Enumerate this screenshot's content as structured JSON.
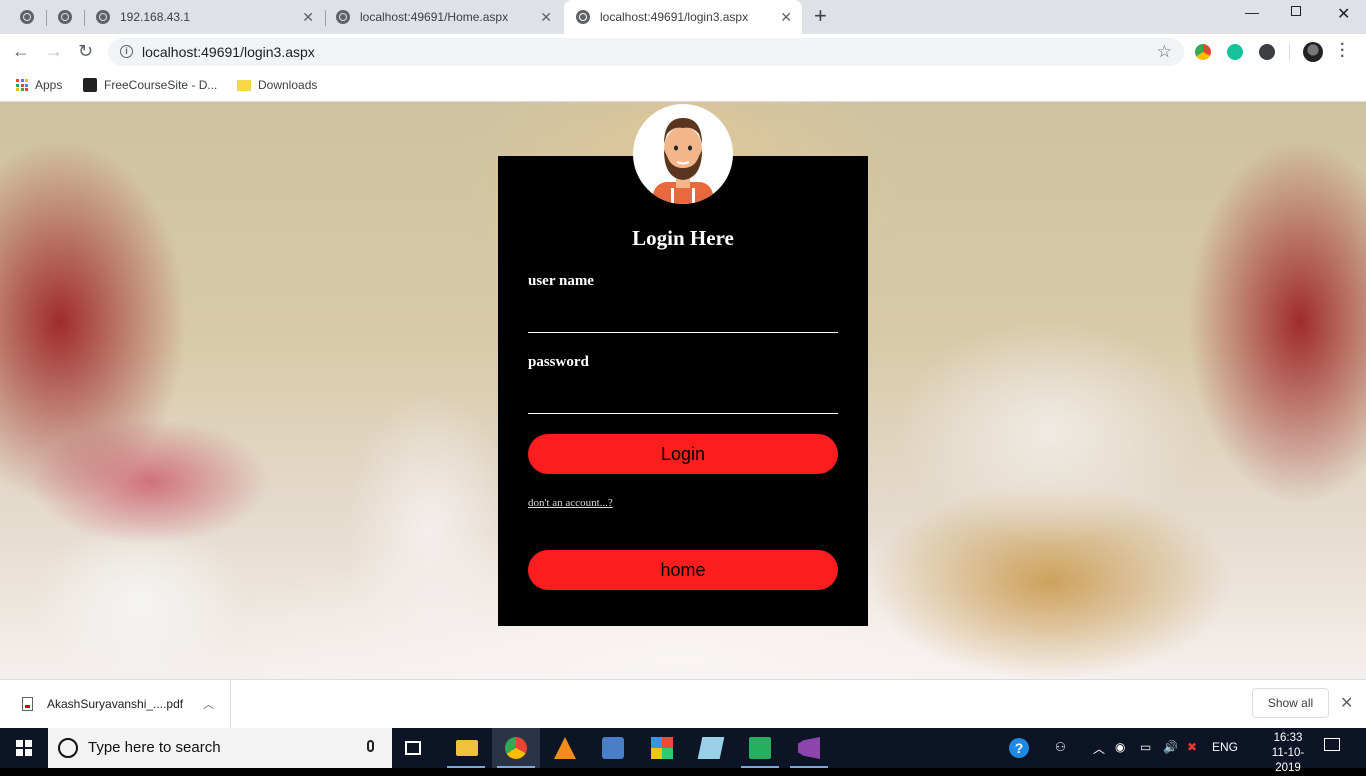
{
  "browser": {
    "tabs": [
      {
        "label": ""
      },
      {
        "label": ""
      },
      {
        "label": "192.168.43.1"
      },
      {
        "label": "localhost:49691/Home.aspx"
      },
      {
        "label": "localhost:49691/login3.aspx",
        "active": true
      }
    ],
    "new_tab_symbol": "+",
    "url": "localhost:49691/login3.aspx",
    "bookmarks": [
      {
        "label": "Apps",
        "icon": "apps-grid-icon"
      },
      {
        "label": "FreeCourseSite - D...",
        "icon": "site-favicon"
      },
      {
        "label": "Downloads",
        "icon": "folder-icon"
      }
    ],
    "extensions": [
      "chrome-color-icon",
      "grammarly-icon",
      "k-extension-icon",
      "profile-avatar"
    ]
  },
  "login": {
    "title": "Login Here",
    "username_label": "user name",
    "username_value": "",
    "password_label": "password",
    "password_value": "",
    "login_button": "Login",
    "register_link": "don't an account...?",
    "home_button": "home",
    "colors": {
      "card_bg": "#000000",
      "button": "#fc1e1e",
      "text": "#ffffff"
    }
  },
  "download_shelf": {
    "file_name": "AkashSuryavanshi_....pdf",
    "show_all": "Show all"
  },
  "taskbar": {
    "search_placeholder": "Type here to search",
    "language": "ENG",
    "time": "16:33",
    "date": "11-10-2019",
    "pinned": [
      "task-view-icon",
      "file-explorer-icon",
      "chrome-icon",
      "vlc-icon",
      "network-app-icon",
      "office-icon",
      "notes-icon",
      "spreadsheet-icon",
      "visual-studio-icon"
    ]
  }
}
